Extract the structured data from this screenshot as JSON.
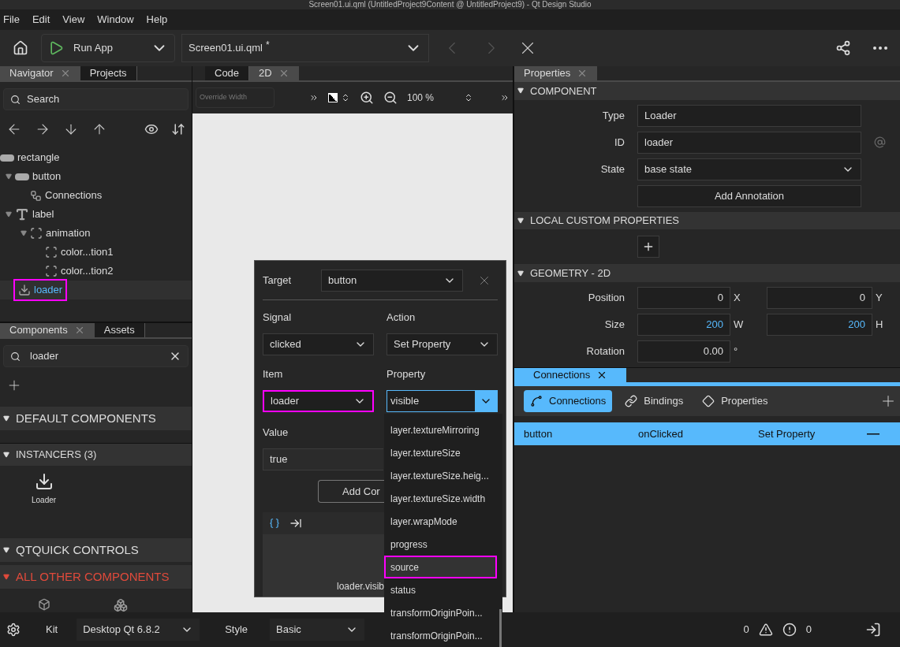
{
  "window": {
    "title": "Screen01.ui.qml (UntitledProject9Content @ UntitledProject9) - Qt Design Studio"
  },
  "menu": [
    "File",
    "Edit",
    "View",
    "Window",
    "Help"
  ],
  "toolbar": {
    "run": "Run App",
    "document": "Screen01.ui.qml",
    "modified_mark": "*"
  },
  "navigator": {
    "tabs": [
      {
        "label": "Navigator",
        "selected": true
      },
      {
        "label": "Projects",
        "selected": false
      }
    ],
    "search": {
      "placeholder": "Search"
    },
    "tree": [
      {
        "label": "rectangle",
        "kind": "rect",
        "selected": false,
        "highlighted": false,
        "children": [
          {
            "label": "button",
            "kind": "rect",
            "expanded": true,
            "selected": false,
            "highlighted": false,
            "children": [
              {
                "label": "Connections",
                "kind": "connections",
                "expanded": false,
                "selected": false,
                "highlighted": false
              }
            ]
          },
          {
            "label": "label",
            "kind": "text",
            "expanded": true,
            "selected": false,
            "highlighted": false,
            "children": [
              {
                "label": "animation",
                "kind": "anim",
                "expanded": true,
                "selected": false,
                "highlighted": false,
                "children": [
                  {
                    "label": "color...tion1",
                    "kind": "anim",
                    "expanded": false,
                    "selected": false,
                    "highlighted": false
                  },
                  {
                    "label": "color...tion2",
                    "kind": "anim",
                    "expanded": false,
                    "selected": false,
                    "highlighted": false
                  }
                ]
              }
            ]
          },
          {
            "label": "loader",
            "kind": "loader",
            "expanded": false,
            "selected": true,
            "highlighted": true
          }
        ]
      }
    ]
  },
  "components": {
    "tabs": [
      {
        "label": "Components",
        "selected": true
      },
      {
        "label": "Assets",
        "selected": false
      }
    ],
    "search": {
      "value": "loader"
    },
    "sections": [
      {
        "title": "DEFAULT COMPONENTS",
        "expanded": true,
        "alert": false
      },
      {
        "title": "INSTANCERS (3)",
        "expanded": true,
        "alert": false,
        "items": [
          "Loader"
        ]
      },
      {
        "title": "QTQUICK CONTROLS",
        "expanded": true,
        "alert": false
      },
      {
        "title": "ALL OTHER COMPONENTS",
        "expanded": true,
        "alert": true
      }
    ]
  },
  "editor": {
    "tabs": [
      {
        "label": "Code",
        "selected": false
      },
      {
        "label": "2D",
        "selected": true
      }
    ],
    "override_width": {
      "placeholder": "Override Width"
    },
    "zoom": "100 %"
  },
  "connection_editor": {
    "target_label": "Target",
    "target": "button",
    "signal_label": "Signal",
    "signal": "clicked",
    "action_label": "Action",
    "action": "Set Property",
    "item_label": "Item",
    "item": {
      "value": "loader",
      "highlighted": true
    },
    "property_label": "Property",
    "property": "visible",
    "value_label": "Value",
    "value": "true",
    "add_button": "Add Cor",
    "code_preview": "loader.visib",
    "property_options": [
      {
        "label": "layer.textureMirroring",
        "selected": false,
        "highlighted": false
      },
      {
        "label": "layer.textureSize",
        "selected": false,
        "highlighted": false
      },
      {
        "label": "layer.textureSize.heig...",
        "selected": false,
        "highlighted": false
      },
      {
        "label": "layer.textureSize.width",
        "selected": false,
        "highlighted": false
      },
      {
        "label": "layer.wrapMode",
        "selected": false,
        "highlighted": false
      },
      {
        "label": "progress",
        "selected": false,
        "highlighted": false
      },
      {
        "label": "source",
        "selected": true,
        "highlighted": true
      },
      {
        "label": "status",
        "selected": false,
        "highlighted": false
      },
      {
        "label": "transformOriginPoin...",
        "selected": false,
        "highlighted": false
      },
      {
        "label": "transformOriginPoin...",
        "selected": false,
        "highlighted": false
      }
    ]
  },
  "properties": {
    "tab": "Properties",
    "component": {
      "title": "COMPONENT",
      "type_label": "Type",
      "type": "Loader",
      "id_label": "ID",
      "id_value": "loader",
      "state_label": "State",
      "state": "base state",
      "annotation_button": "Add Annotation"
    },
    "custom": {
      "title": "LOCAL CUSTOM PROPERTIES"
    },
    "geometry": {
      "title": "GEOMETRY - 2D",
      "rows": [
        {
          "label": "Position",
          "a": "0",
          "a_unit": "X",
          "b": "0",
          "b_unit": "Y",
          "changed": false
        },
        {
          "label": "Size",
          "a": "200",
          "a_unit": "W",
          "b": "200",
          "b_unit": "H",
          "changed": true
        },
        {
          "label": "Rotation",
          "a": "0.00",
          "a_unit": "°",
          "changed": false
        }
      ]
    }
  },
  "connections": {
    "tab": "Connections",
    "modes": [
      {
        "label": "Connections",
        "kind": "connections",
        "selected": true
      },
      {
        "label": "Bindings",
        "kind": "bindings",
        "selected": false
      },
      {
        "label": "Properties",
        "kind": "properties",
        "selected": false
      }
    ],
    "rows": [
      {
        "source": "button",
        "signal": "onClicked",
        "action": "Set Property",
        "selected": true
      }
    ]
  },
  "status_bar": {
    "kit_label": "Kit",
    "kit": "Desktop Qt 6.8.2",
    "style_label": "Style",
    "style": "Basic",
    "warnings": "0",
    "errors": "0"
  }
}
